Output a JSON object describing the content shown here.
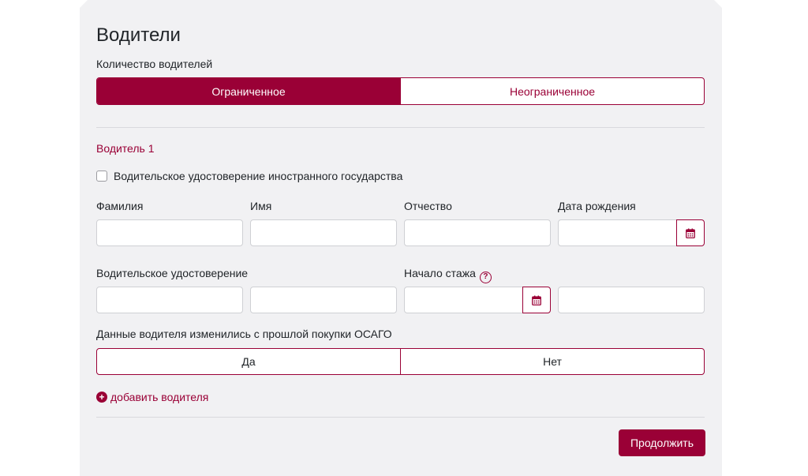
{
  "page": {
    "title": "Водители"
  },
  "drivers_count": {
    "label": "Количество водителей",
    "options": [
      "Ограниченное",
      "Неограниченное"
    ],
    "selected": "Ограниченное"
  },
  "driver": {
    "title": "Водитель 1",
    "foreign_license_label": "Водительское удостоверение иностранного государства",
    "foreign_license_checked": false,
    "fields": {
      "last_name": {
        "label": "Фамилия",
        "value": ""
      },
      "first_name": {
        "label": "Имя",
        "value": ""
      },
      "patronymic": {
        "label": "Отчество",
        "value": ""
      },
      "birth_date": {
        "label": "Дата рождения",
        "value": ""
      },
      "license_series": {
        "label": "Водительское удостоверение",
        "value": ""
      },
      "license_number": {
        "value": ""
      },
      "experience_start": {
        "label": "Начало стажа",
        "value": "",
        "help": "?"
      },
      "extra_field": {
        "value": ""
      }
    },
    "changed_since_last": {
      "label": "Данные водителя изменились с прошлой покупки ОСАГО",
      "options": [
        "Да",
        "Нет"
      ],
      "selected": null
    }
  },
  "actions": {
    "add_driver": "добавить водителя",
    "add_driver_icon": "+",
    "continue": "Продолжить"
  },
  "icons": {
    "calendar": "calendar-icon",
    "help": "help-circle-icon",
    "add": "plus-circle-icon"
  },
  "colors": {
    "accent": "#9a0036",
    "panel_bg": "#f1f1f3",
    "input_border": "#cfd0d4"
  }
}
